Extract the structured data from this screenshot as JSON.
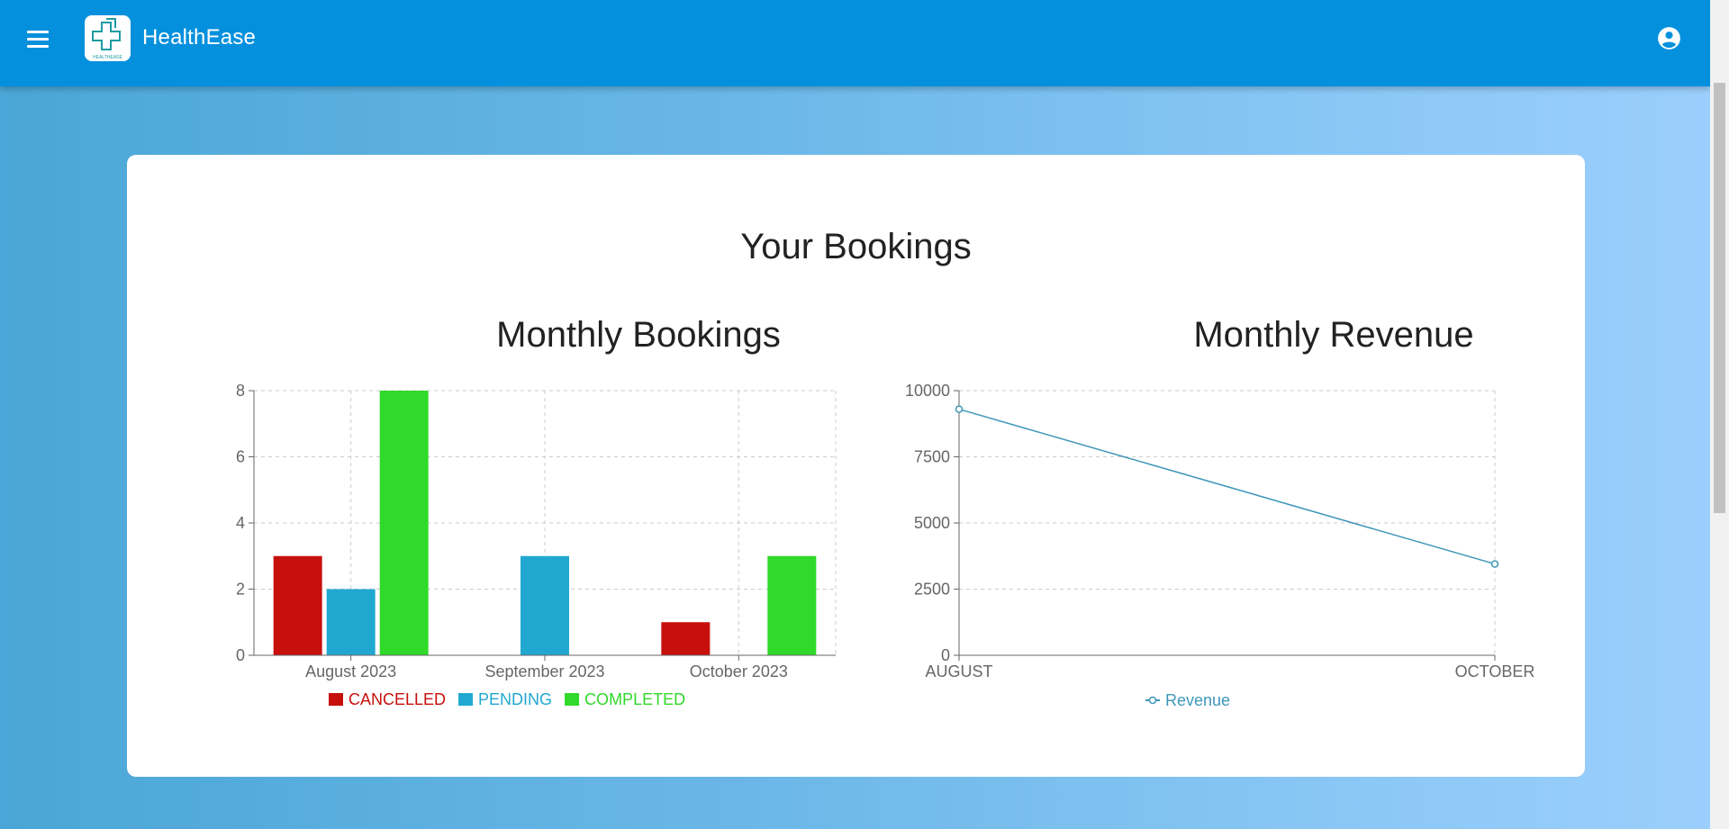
{
  "app": {
    "title": "HealthEase",
    "logo_text": "HEALTHEASE"
  },
  "page": {
    "title": "Your Bookings"
  },
  "colors": {
    "appbar": "#0590dd",
    "cancelled": "#c7100c",
    "pending": "#21a8d1",
    "completed": "#31d92a",
    "revenue": "#3e97b8"
  },
  "icons": {
    "menu": "menu-icon",
    "account": "account-circle-icon"
  },
  "chart_data": [
    {
      "type": "bar",
      "title": "Monthly Bookings",
      "categories": [
        "August 2023",
        "September 2023",
        "October 2023"
      ],
      "series": [
        {
          "name": "CANCELLED",
          "values": [
            3,
            0,
            1
          ],
          "color": "#c7100c"
        },
        {
          "name": "PENDING",
          "values": [
            2,
            3,
            0
          ],
          "color": "#21a8d1"
        },
        {
          "name": "COMPLETED",
          "values": [
            8,
            0,
            3
          ],
          "color": "#31d92a"
        }
      ],
      "yticks": [
        0,
        2,
        4,
        6,
        8
      ],
      "ylim": [
        0,
        8
      ],
      "grid": true,
      "legend": "bottom"
    },
    {
      "type": "line",
      "title": "Monthly Revenue",
      "x": [
        "AUGUST",
        "OCTOBER"
      ],
      "series": [
        {
          "name": "Revenue",
          "values": [
            9300,
            3450
          ],
          "color": "#3e97b8"
        }
      ],
      "yticks": [
        0,
        2500,
        5000,
        7500,
        10000
      ],
      "ylim": [
        0,
        10000
      ],
      "grid": true,
      "legend": "bottom"
    }
  ]
}
